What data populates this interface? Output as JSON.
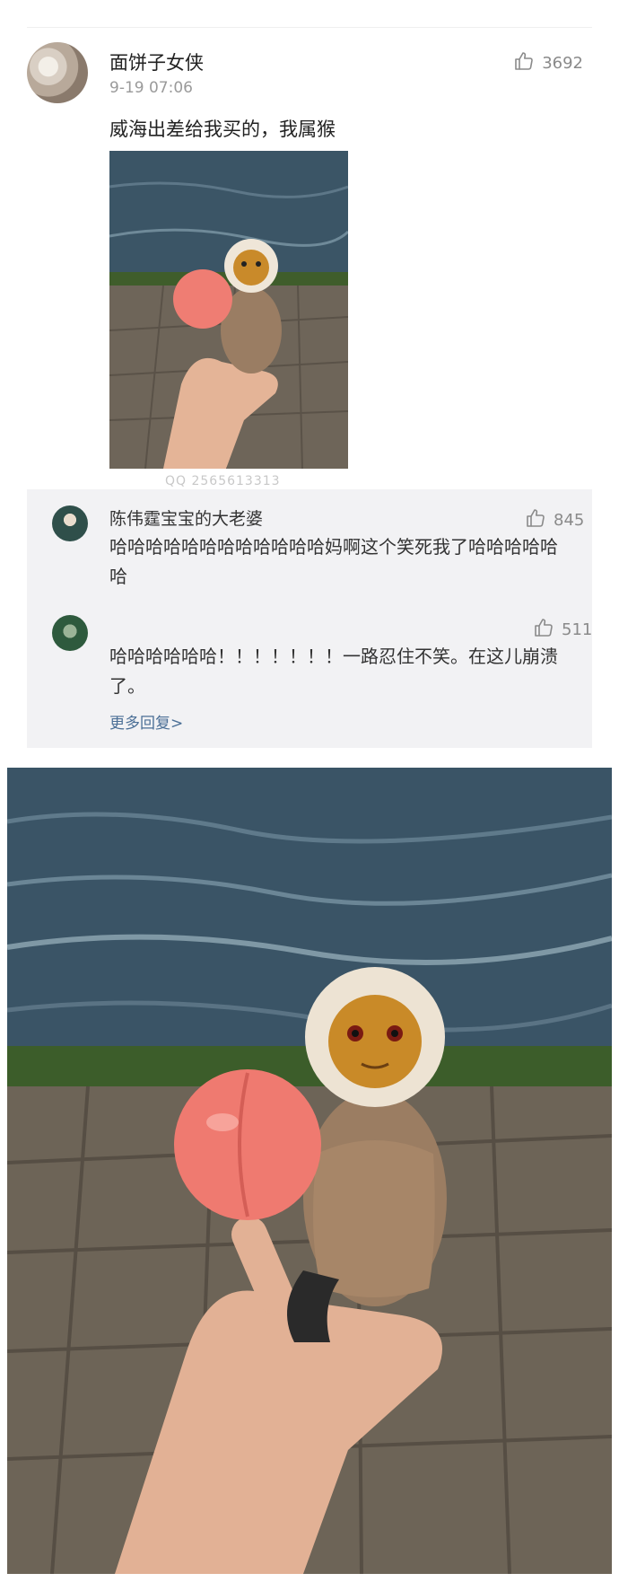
{
  "post": {
    "user_name": "面饼子女侠",
    "time": "9-19 07:06",
    "likes": "3692",
    "text": "威海出差给我买的，我属猴",
    "watermark": "QQ 2565613313"
  },
  "comments": [
    {
      "user_name": "陈伟霆宝宝的大老婆",
      "likes": "845",
      "text": "哈哈哈哈哈哈哈哈哈哈哈哈妈啊这个笑死我了哈哈哈哈哈哈"
    },
    {
      "user_name": "",
      "likes": "511",
      "text": "哈哈哈哈哈哈！！！！！！！一路忍住不笑。在这儿崩溃了。"
    }
  ],
  "more_replies": "更多回复>",
  "icons": {
    "like": "thumbs-up-icon"
  },
  "colors": {
    "link": "#4b6f96",
    "comment_bg": "#f2f2f4",
    "meta": "#9a9a9a"
  }
}
